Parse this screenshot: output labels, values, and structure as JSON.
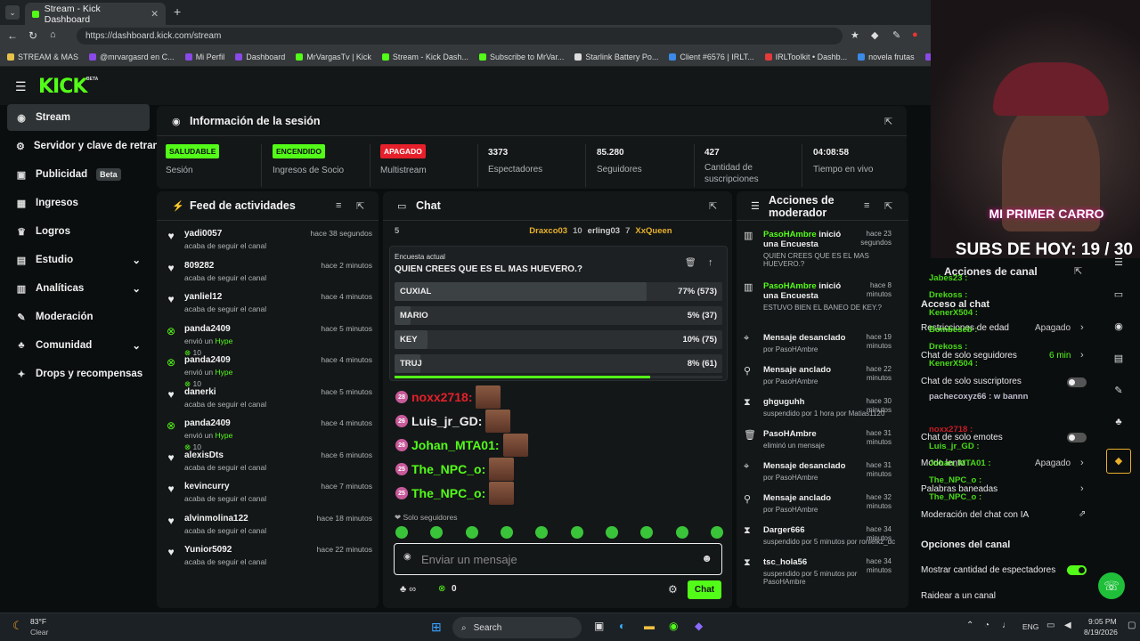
{
  "browser": {
    "tab_title": "Stream - Kick Dashboard",
    "url": "https://dashboard.kick.com/stream",
    "bookmarks": [
      "STREAM & MAS",
      "@mrvargasrd en C...",
      "Mi Perfil",
      "Dashboard",
      "MrVargasTv | Kick",
      "Stream - Kick Dash...",
      "Subscribe to MrVar...",
      "Starlink Battery Po...",
      "Client #6576 | IRLT...",
      "IRLToolkit • Dashb...",
      "novela frutas",
      "Cu"
    ]
  },
  "app": {
    "logo": "KICK",
    "beta": "BETA"
  },
  "sidebar": {
    "items": [
      {
        "label": "Stream",
        "icon": "broadcast-icon"
      },
      {
        "label": "Servidor y clave de retrans",
        "icon": "key-icon"
      },
      {
        "label": "Publicidad",
        "badge": "Beta",
        "icon": "ad-icon"
      },
      {
        "label": "Ingresos",
        "icon": "money-icon"
      },
      {
        "label": "Logros",
        "icon": "trophy-icon"
      },
      {
        "label": "Estudio",
        "icon": "studio-icon"
      },
      {
        "label": "Analíticas",
        "icon": "chart-icon"
      },
      {
        "label": "Moderación",
        "icon": "wrench-icon"
      },
      {
        "label": "Comunidad",
        "icon": "community-icon"
      },
      {
        "label": "Drops y recompensas",
        "icon": "gift-icon"
      }
    ]
  },
  "session": {
    "title": "Información de la sesión",
    "stats": [
      {
        "badge": "SALUDABLE",
        "label": "Sesión",
        "color": "#53fc18"
      },
      {
        "badge": "ENCENDIDO",
        "label": "Ingresos de Socio",
        "color": "#53fc18"
      },
      {
        "badge": "APAGADO",
        "label": "Multistream",
        "color": "#e5202a"
      },
      {
        "value": "3373",
        "label": "Espectadores"
      },
      {
        "value": "85.280",
        "label": "Seguidores"
      },
      {
        "value": "427",
        "label": "Cantidad de suscripciones"
      },
      {
        "value": "04:08:58",
        "label": "Tiempo en vivo"
      }
    ]
  },
  "feed": {
    "title": "Feed de actividades",
    "items": [
      {
        "name": "yadi0057",
        "sub": "acaba de seguir el canal",
        "time": "hace 38 segundos"
      },
      {
        "name": "809282",
        "sub": "acaba de seguir el canal",
        "time": "hace 2 minutos"
      },
      {
        "name": "yanliel12",
        "sub": "acaba de seguir el canal",
        "time": "hace 4 minutos"
      },
      {
        "name": "panda2409",
        "sub": "envió un",
        "hype": "Hype",
        "count": "10",
        "time": "hace 5 minutos"
      },
      {
        "name": "panda2409",
        "sub": "envió un",
        "hype": "Hype",
        "count": "10",
        "time": "hace 4 minutos"
      },
      {
        "name": "danerki",
        "sub": "acaba de seguir el canal",
        "time": "hace 5 minutos"
      },
      {
        "name": "panda2409",
        "sub": "envió un",
        "hype": "Hype",
        "count": "10",
        "time": "hace 4 minutos"
      },
      {
        "name": "alexisDts",
        "sub": "acaba de seguir el canal",
        "time": "hace 6 minutos"
      },
      {
        "name": "kevincurry",
        "sub": "acaba de seguir el canal",
        "time": "hace 7 minutos"
      },
      {
        "name": "alvinmolina122",
        "sub": "acaba de seguir el canal",
        "time": "hace 18 minutos"
      },
      {
        "name": "Yunior5092",
        "sub": "acaba de seguir el canal",
        "time": "hace 22 minutos"
      }
    ]
  },
  "chat": {
    "title": "Chat",
    "top": [
      "5",
      "Draxco03",
      "10",
      "erling03",
      "7",
      "XxQueen"
    ],
    "poll": {
      "label": "Encuesta actual",
      "question": "QUIEN CREES QUE ES EL MAS HUEVERO.?",
      "options": [
        {
          "name": "CUXIAL",
          "result": "77% (573)",
          "pct": 77
        },
        {
          "name": "MARIO",
          "result": "5% (37)",
          "pct": 5
        },
        {
          "name": "KEY",
          "result": "10% (75)",
          "pct": 10
        },
        {
          "name": "TRUJ",
          "result": "8% (61)",
          "pct": 8
        }
      ],
      "progress": 78
    },
    "messages": [
      {
        "user": "noxx2718:",
        "color": "#e5202a",
        "badge": "28"
      },
      {
        "user": "Luis_jr_GD:",
        "color": "#eeeeee",
        "badge": "26"
      },
      {
        "user": "Johan_MTA01:",
        "color": "#53fc18",
        "badge": "26"
      },
      {
        "user": "The_NPC_o:",
        "color": "#53fc18",
        "badge": "25"
      },
      {
        "user": "The_NPC_o:",
        "color": "#53fc18",
        "badge": "25"
      }
    ],
    "followers_only": "Solo seguidores",
    "placeholder": "Enviar un mensaje",
    "count": "0",
    "send": "Chat"
  },
  "mod": {
    "title": "Acciones de moderador",
    "items": [
      {
        "t1": "PasoHAmbre",
        "t2": " inició una Encuesta",
        "s": "QUIEN CREES QUE ES EL MAS HUEVERO.?",
        "time": "hace 23 segundos",
        "icon": "poll-icon"
      },
      {
        "t1": "PasoHAmbre",
        "t2": " inició una Encuesta",
        "s": "ESTUVO BIEN EL BANEO DE KEY.?",
        "time": "hace 8 minutos",
        "icon": "poll-icon"
      },
      {
        "t1": "Mensaje desanclado",
        "s": "por PasoHAmbre",
        "time": "hace 19 minutos",
        "icon": "unpin-icon"
      },
      {
        "t1": "Mensaje anclado",
        "s": "por PasoHAmbre",
        "time": "hace 22 minutos",
        "icon": "pin-icon"
      },
      {
        "t1": "ghguguhh",
        "s": "suspendido por 1 hora por Matias1120",
        "time": "hace 30 minutos",
        "icon": "hourglass-icon"
      },
      {
        "t1": "PasoHAmbre",
        "s": "eliminó un mensaje",
        "time": "hace 31 minutos",
        "icon": "trash-icon"
      },
      {
        "t1": "Mensaje desanclado",
        "s": "por PasoHAmbre",
        "time": "hace 31 minutos",
        "icon": "unpin-icon"
      },
      {
        "t1": "Mensaje anclado",
        "s": "por PasoHAmbre",
        "time": "hace 32 minutos",
        "icon": "pin-icon"
      },
      {
        "t1": "Darger666",
        "s": "suspendido por 5 minutos por ronielkz_dc",
        "time": "hace 34 minutos",
        "icon": "hourglass-icon"
      },
      {
        "t1": "tsc_hola56",
        "s": "suspendido por 5 minutos por PasoHAmbre",
        "time": "hace 34 minutos",
        "icon": "hourglass-icon"
      }
    ]
  },
  "overlay": {
    "cam_text": "MI PRIMER CARRO",
    "subs": "SUBS DE HOY: 19 / 30",
    "channel_actions": "Acciones de canal",
    "chat_access": "Acceso al chat",
    "rows": [
      {
        "label": "Restricciones de edad",
        "value": "Apagado"
      },
      {
        "label": "Chat de solo seguidores",
        "value": "6 min"
      },
      {
        "label": "Chat de solo suscriptores",
        "value": ""
      },
      {
        "label": "Chat de solo emotes",
        "value": ""
      },
      {
        "label": "Modo lento",
        "value": "Apagado"
      },
      {
        "label": "Palabras baneadas",
        "value": ""
      },
      {
        "label": "Moderación del chat con IA",
        "value": ""
      }
    ],
    "channel_options": "Opciones del canal",
    "show_viewers": "Mostrar cantidad de espectadores",
    "raid": "Raidear a un canal",
    "chat_names": [
      "Jabes23 :",
      "Drekoss :",
      "KenerX504 :",
      "Bombeseb :",
      "Drekoss :",
      "KenerX504 :",
      "pachecoxyz66 : w bannn",
      "noxx2718 :",
      "Luis_jr_GD :",
      "Johan_MTA01 :",
      "The_NPC_o :",
      "The_NPC_o :"
    ]
  },
  "taskbar": {
    "temp": "83°F",
    "weather": "Clear",
    "search": "Search",
    "lang": "ENG",
    "time": "9:05 PM",
    "date": "8/19/2026"
  }
}
